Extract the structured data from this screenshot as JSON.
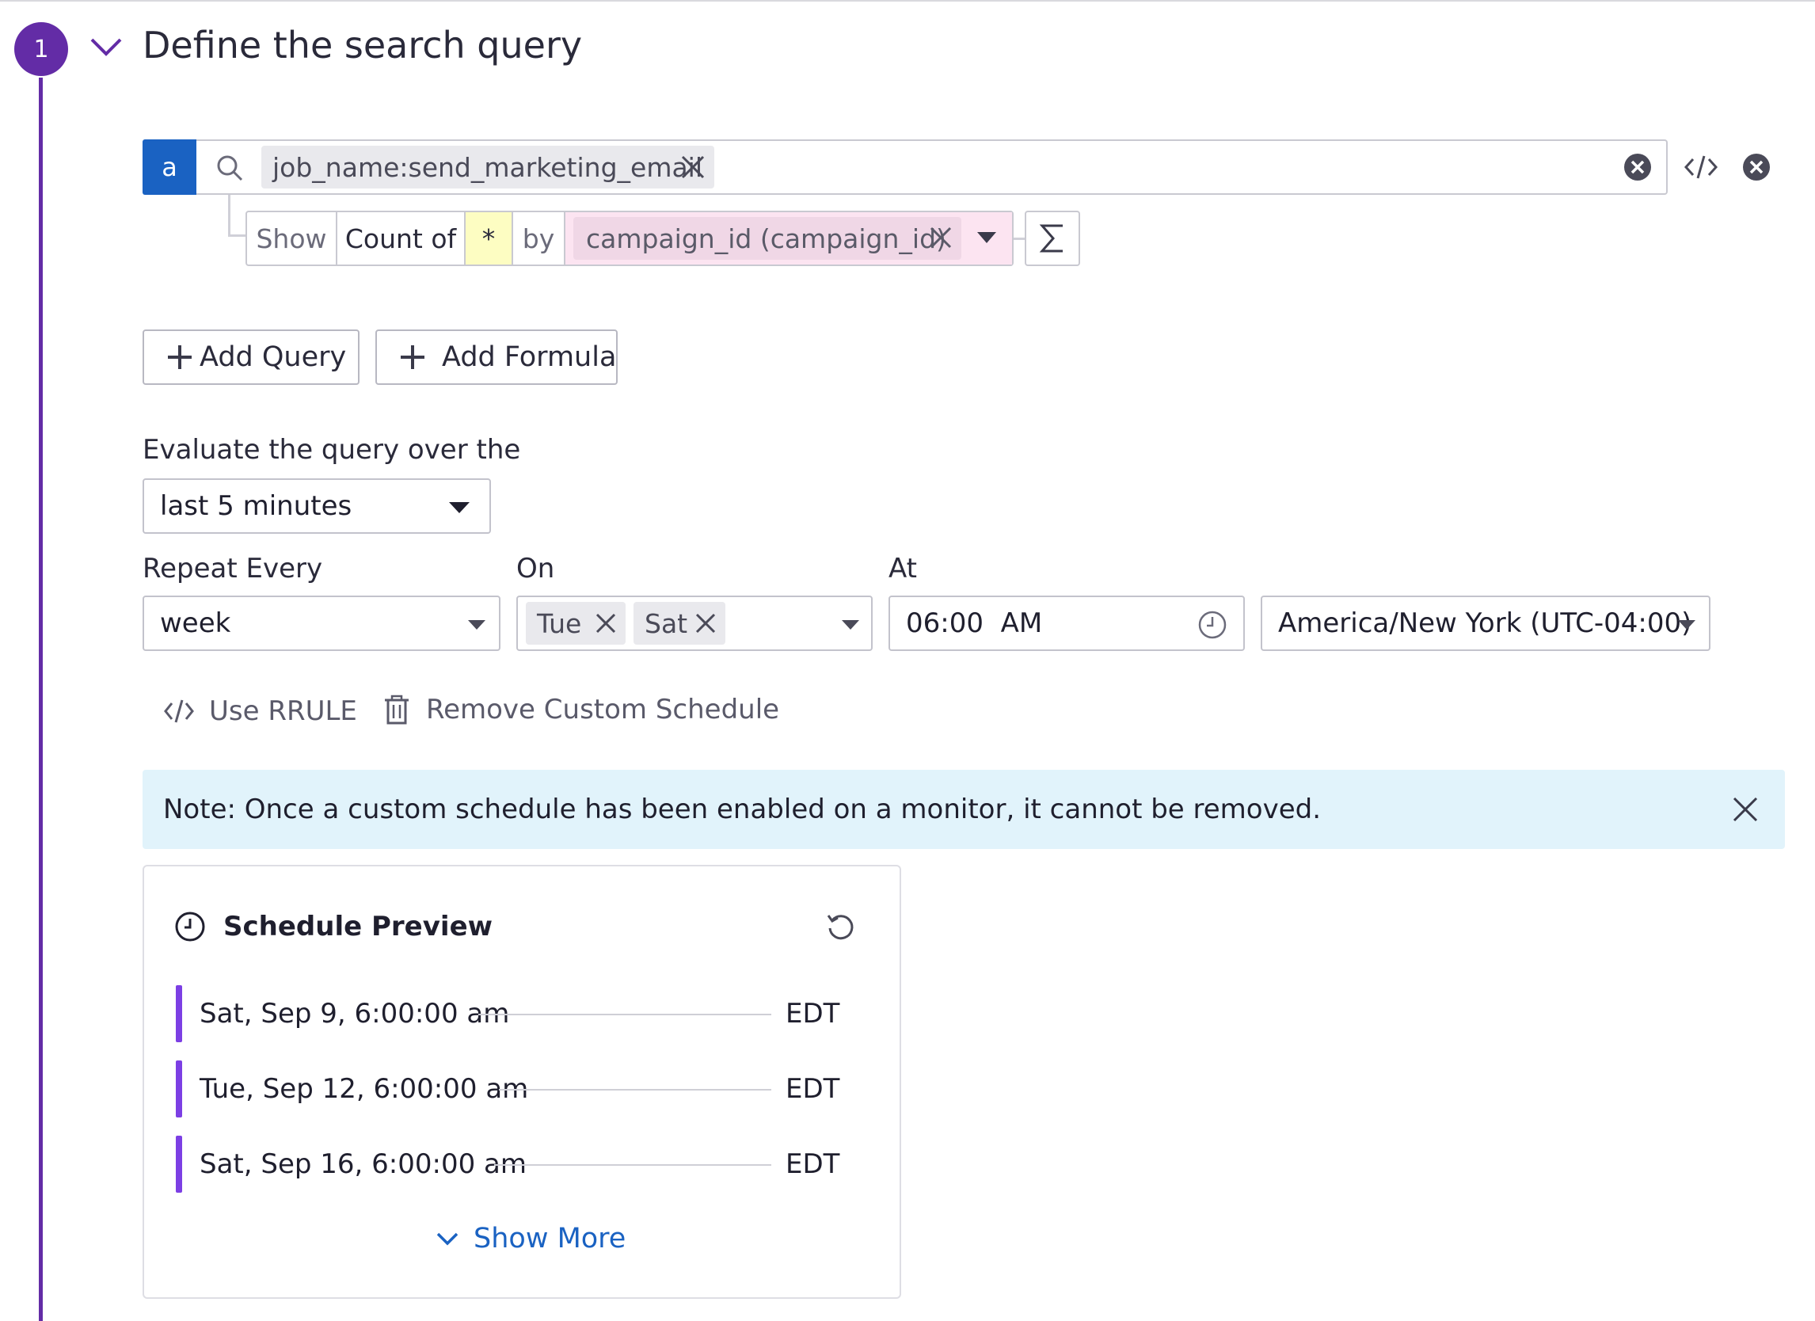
{
  "step": {
    "number": "1",
    "title": "Define the search query"
  },
  "query": {
    "letter": "a",
    "filter_chip": "job_name:send_marketing_email",
    "aggregation": {
      "show_label": "Show",
      "function_label": "Count of",
      "measure": "*",
      "by_label": "by",
      "group_chip": "campaign_id (campaign_id)"
    }
  },
  "buttons": {
    "add_query": "Add Query",
    "add_formula": "Add Formula"
  },
  "evaluate": {
    "label": "Evaluate the query over the",
    "value": "last 5 minutes"
  },
  "schedule": {
    "repeat_label": "Repeat Every",
    "repeat_value": "week",
    "on_label": "On",
    "days": [
      "Tue",
      "Sat"
    ],
    "at_label": "At",
    "time_value": "06:00  AM",
    "timezone_value": "America/New York (UTC-04:00)"
  },
  "actions": {
    "use_rrule": "Use RRULE",
    "remove_schedule": "Remove Custom Schedule"
  },
  "note": "Note: Once a custom schedule has been enabled on a monitor, it cannot be removed.",
  "preview": {
    "title": "Schedule Preview",
    "runs": [
      {
        "date": "Sat, Sep 9, 6:00:00 am",
        "tz": "EDT"
      },
      {
        "date": "Tue, Sep 12, 6:00:00 am",
        "tz": "EDT"
      },
      {
        "date": "Sat, Sep 16, 6:00:00 am",
        "tz": "EDT"
      }
    ],
    "show_more": "Show More"
  },
  "colors": {
    "step_purple": "#632ca6",
    "query_blue": "#1a62c2",
    "run_bar": "#7c3fe4",
    "note_bg": "#e1f3fb"
  }
}
